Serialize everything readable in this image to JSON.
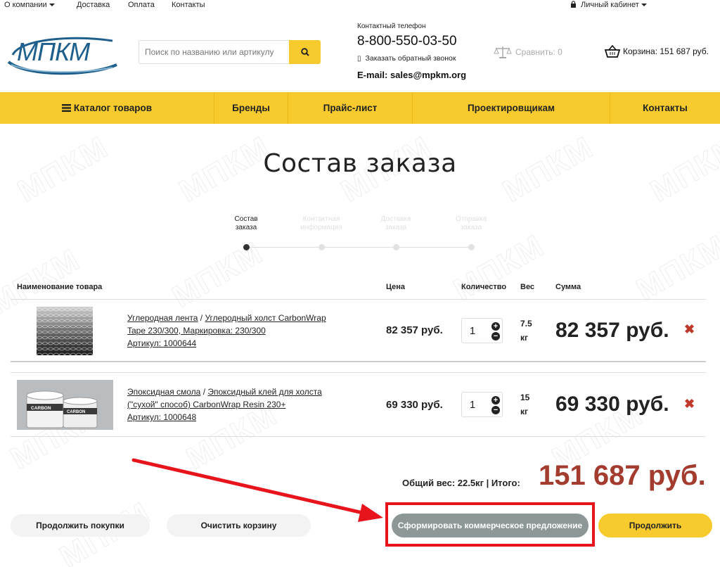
{
  "topbar": {
    "about": "О компании",
    "delivery": "Доставка",
    "payment": "Оплата",
    "contacts": "Контакты",
    "account": "Личный кабинет"
  },
  "header": {
    "logo_text": "МПКМ",
    "search_placeholder": "Поиск по названию или артикулу",
    "contact_label": "Контактный телефон",
    "phone": "8-800-550-03-50",
    "callback": "Заказать обратный звонок",
    "email": "E-mail: sales@mpkm.org",
    "compare": "Сравнить: 0",
    "cart": "Корзина: 151 687 руб."
  },
  "nav": [
    {
      "label": "Каталог товаров",
      "icon": "menu-icon"
    },
    {
      "label": "Бренды"
    },
    {
      "label": "Прайс-лист"
    },
    {
      "label": "Проектировщикам"
    },
    {
      "label": "Контакты"
    }
  ],
  "page_title": "Состав заказа",
  "steps": [
    {
      "label_1": "Состав",
      "label_2": "заказа",
      "active": true
    },
    {
      "label_1": "Контактная",
      "label_2": "информация",
      "active": false
    },
    {
      "label_1": "Доставка",
      "label_2": "заказа",
      "active": false
    },
    {
      "label_1": "Отправка",
      "label_2": "заказа",
      "active": false
    }
  ],
  "table_headers": {
    "name": "Наименование товара",
    "price": "Цена",
    "qty": "Количество",
    "weight": "Вес",
    "sum": "Сумма"
  },
  "items": [
    {
      "category": "Углеродная лента",
      "name_line1": "Углеродный холст CarbonWrap",
      "name_line2": "Tape 230/300, Маркировка: 230/300",
      "article": "Артикул: 1000644",
      "price": "82 357 руб.",
      "qty": "1",
      "weight_value": "7.5",
      "weight_unit": "кг",
      "sum": "82 357 руб."
    },
    {
      "category": "Эпоксидная смола",
      "name_line1": "Эпоксидный клей для холста",
      "name_line2": "(\"сухой\" способ) CarbonWrap Resin 230+",
      "article": "Артикул: 1000648",
      "price": "69 330 руб.",
      "qty": "1",
      "weight_value": "15",
      "weight_unit": "кг",
      "sum": "69 330 руб."
    }
  ],
  "totals": {
    "label": "Общий вес: 22.5кг | Итого:",
    "total": "151 687 руб."
  },
  "buttons": {
    "continue_shopping": "Продолжить покупки",
    "clear_cart": "Очистить корзину",
    "make_offer": "Сформировать коммерческое предложение",
    "continue": "Продолжить"
  },
  "colors": {
    "accent": "#f7cb2d",
    "total_red": "#a33b2f",
    "highlight": "#e8141c",
    "offer_button": "#8e9797"
  }
}
